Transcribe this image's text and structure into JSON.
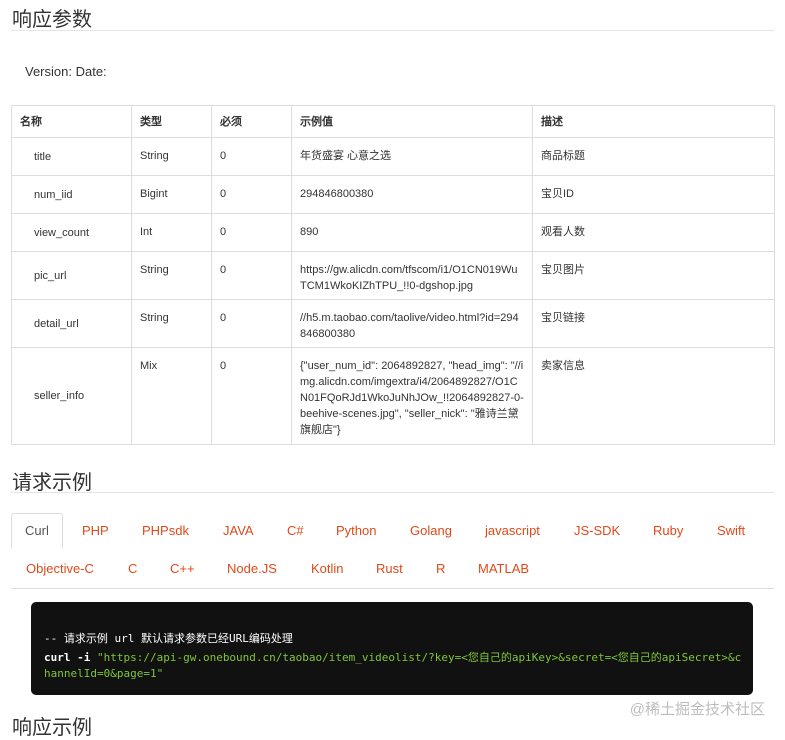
{
  "sections": {
    "response_params": "响应参数",
    "request_example": "请求示例",
    "response_example": "响应示例"
  },
  "version_line": "Version: Date:",
  "table": {
    "headers": [
      "名称",
      "类型",
      "必须",
      "示例值",
      "描述"
    ],
    "rows": [
      {
        "name": "title",
        "type": "String",
        "required": "0",
        "example": "年货盛宴 心意之选",
        "desc": "商品标题"
      },
      {
        "name": "num_iid",
        "type": "Bigint",
        "required": "0",
        "example": "294846800380",
        "desc": "宝贝ID"
      },
      {
        "name": "view_count",
        "type": "Int",
        "required": "0",
        "example": "890",
        "desc": "观看人数"
      },
      {
        "name": "pic_url",
        "type": "String",
        "required": "0",
        "example": "https://gw.alicdn.com/tfscom/i1/O1CN019WuTCM1WkoKIZhTPU_!!0-dgshop.jpg",
        "desc": "宝贝图片"
      },
      {
        "name": "detail_url",
        "type": "String",
        "required": "0",
        "example": "//h5.m.taobao.com/taolive/video.html?id=294846800380",
        "desc": "宝贝链接"
      },
      {
        "name": "seller_info",
        "type": "Mix",
        "required": "0",
        "example": "{\"user_num_id\": 2064892827, \"head_img\": \"//img.alicdn.com/imgextra/i4/2064892827/O1CN01FQoRJd1WkoJuNhJOw_!!2064892827-0-beehive-scenes.jpg\", \"seller_nick\": \"雅诗兰黛旗舰店\"}",
        "desc": "卖家信息"
      }
    ]
  },
  "tabs": {
    "row1": [
      "Curl",
      "PHP",
      "PHPsdk",
      "JAVA",
      "C#",
      "Python",
      "Golang",
      "javascript",
      "JS-SDK",
      "Ruby",
      "Swift"
    ],
    "row2": [
      "Objective-C",
      "C",
      "C++",
      "Node.JS",
      "Kotlin",
      "Rust",
      "R",
      "MATLAB"
    ]
  },
  "code": {
    "comment": "-- 请求示例 url 默认请求参数已经URL编码处理",
    "cmd": "curl -i",
    "url": "\"https://api-gw.onebound.cn/taobao/item_videolist/?key=<您自己的apiKey>&secret=<您自己的apiSecret>&channelId=0&page=1\""
  },
  "watermark": "@稀土掘金技术社区",
  "colors": {
    "accent": "#e0491a",
    "code_bg": "#111111",
    "code_string": "#7ec63b",
    "border": "#dddddd"
  }
}
